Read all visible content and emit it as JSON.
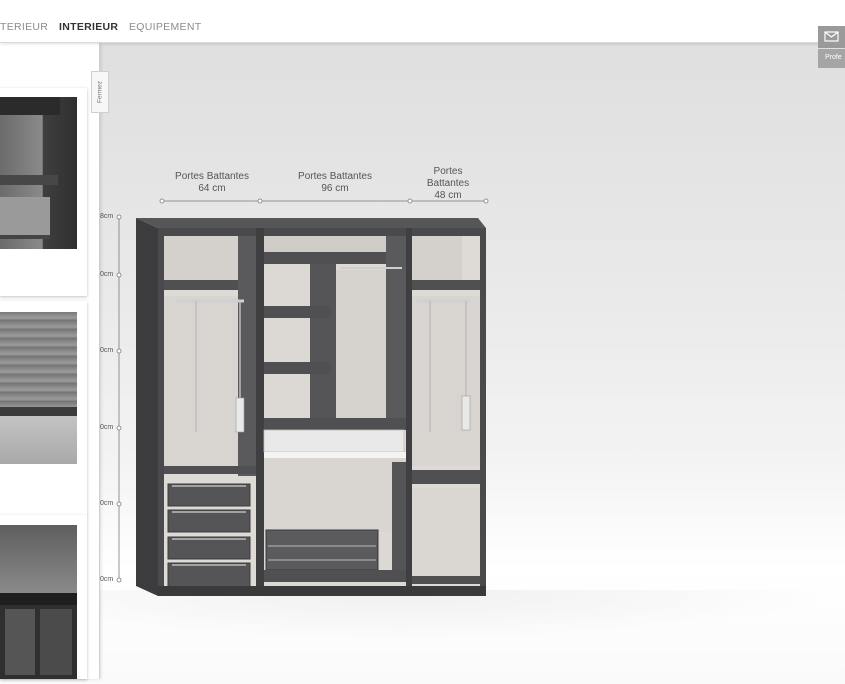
{
  "nav": {
    "tabs": [
      {
        "label": "TERIEUR",
        "active": false
      },
      {
        "label": "INTERIEUR",
        "active": true
      },
      {
        "label": "EQUIPEMENT",
        "active": false
      }
    ]
  },
  "panel": {
    "close_label": "Fermez",
    "thumbnails": [
      {
        "name": "hanging-rail-interior"
      },
      {
        "name": "folded-textiles-shelf"
      },
      {
        "name": "bedding-storage"
      }
    ]
  },
  "contact": {
    "icon": "envelope-icon",
    "pro_label": "Profe"
  },
  "configurator": {
    "columns": [
      {
        "type": "Portes Battantes",
        "width": "64 cm"
      },
      {
        "type": "Portes Battantes",
        "width": "96 cm"
      },
      {
        "type_line1": "Portes",
        "type_line2": "Battantes",
        "width": "48 cm"
      }
    ],
    "height_marks": [
      "8cm",
      "0cm",
      "0cm",
      "0cm",
      "0cm",
      "0cm"
    ]
  },
  "colors": {
    "carcass": "#4a4a4d",
    "interior_back": "#dedbd6",
    "accent_metal": "#c9c9c9"
  }
}
